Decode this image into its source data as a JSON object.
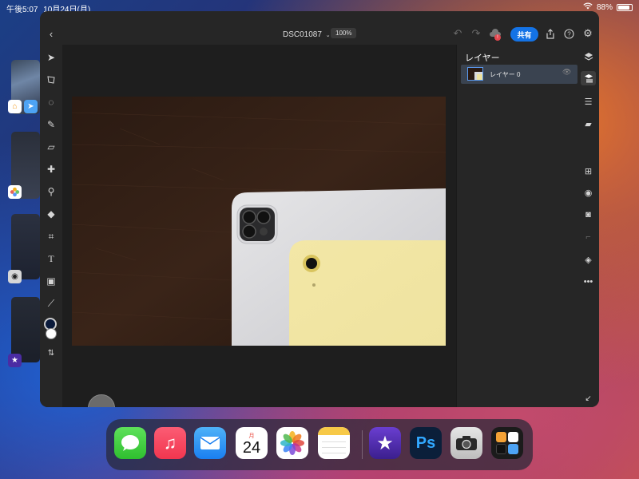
{
  "status_bar": {
    "time": "午後5:07",
    "date": "10月24日(月)",
    "battery": "88%",
    "battery_level": 0.88
  },
  "app": {
    "document_title": "DSC01087",
    "zoom": "100%",
    "share_label": "共有",
    "notification_badge": "!"
  },
  "layers_panel": {
    "title": "レイヤー",
    "layers": [
      {
        "name": "レイヤー 0"
      }
    ]
  },
  "dock": {
    "calendar_weekday": "月",
    "calendar_day": "24",
    "photoshop_label": "Ps"
  },
  "colors": {
    "accent": "#1473e6",
    "foreground_swatch": "#0a1a3a",
    "background_swatch": "#ffffff"
  }
}
